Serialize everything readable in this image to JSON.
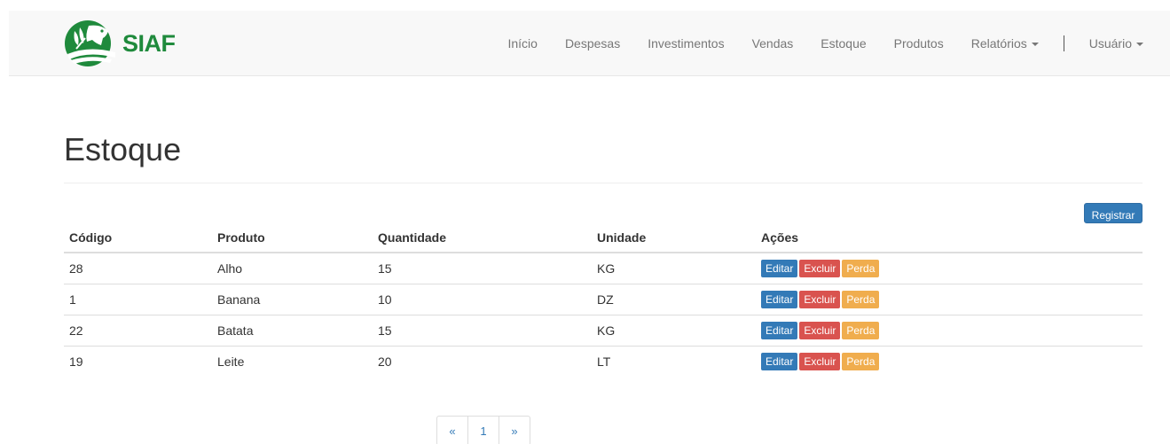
{
  "brand": {
    "name": "SIAF"
  },
  "nav": {
    "items": [
      {
        "id": "inicio",
        "label": "Início"
      },
      {
        "id": "despesas",
        "label": "Despesas"
      },
      {
        "id": "investimentos",
        "label": "Investimentos"
      },
      {
        "id": "vendas",
        "label": "Vendas"
      },
      {
        "id": "estoque",
        "label": "Estoque"
      },
      {
        "id": "produtos",
        "label": "Produtos"
      },
      {
        "id": "relatorios",
        "label": "Relatórios",
        "dropdown": true
      }
    ],
    "user": {
      "label": "Usuário",
      "dropdown": true
    }
  },
  "page": {
    "title": "Estoque",
    "register_label": "Registrar"
  },
  "table": {
    "headers": [
      "Código",
      "Produto",
      "Quantidade",
      "Unidade",
      "Ações"
    ],
    "rows": [
      {
        "code": "28",
        "product": "Alho",
        "qty": "15",
        "unit": "KG"
      },
      {
        "code": "1",
        "product": "Banana",
        "qty": "10",
        "unit": "DZ"
      },
      {
        "code": "22",
        "product": "Batata",
        "qty": "15",
        "unit": "KG"
      },
      {
        "code": "19",
        "product": "Leite",
        "qty": "20",
        "unit": "LT"
      }
    ],
    "actions": {
      "edit": "Editar",
      "delete": "Excluir",
      "loss": "Perda"
    }
  },
  "pagination": {
    "prev": "«",
    "current": "1",
    "next": "»"
  },
  "colors": {
    "brand_green": "#1f8a3c",
    "primary": "#337ab7",
    "danger": "#d9534f",
    "warning": "#f0ad4e"
  }
}
